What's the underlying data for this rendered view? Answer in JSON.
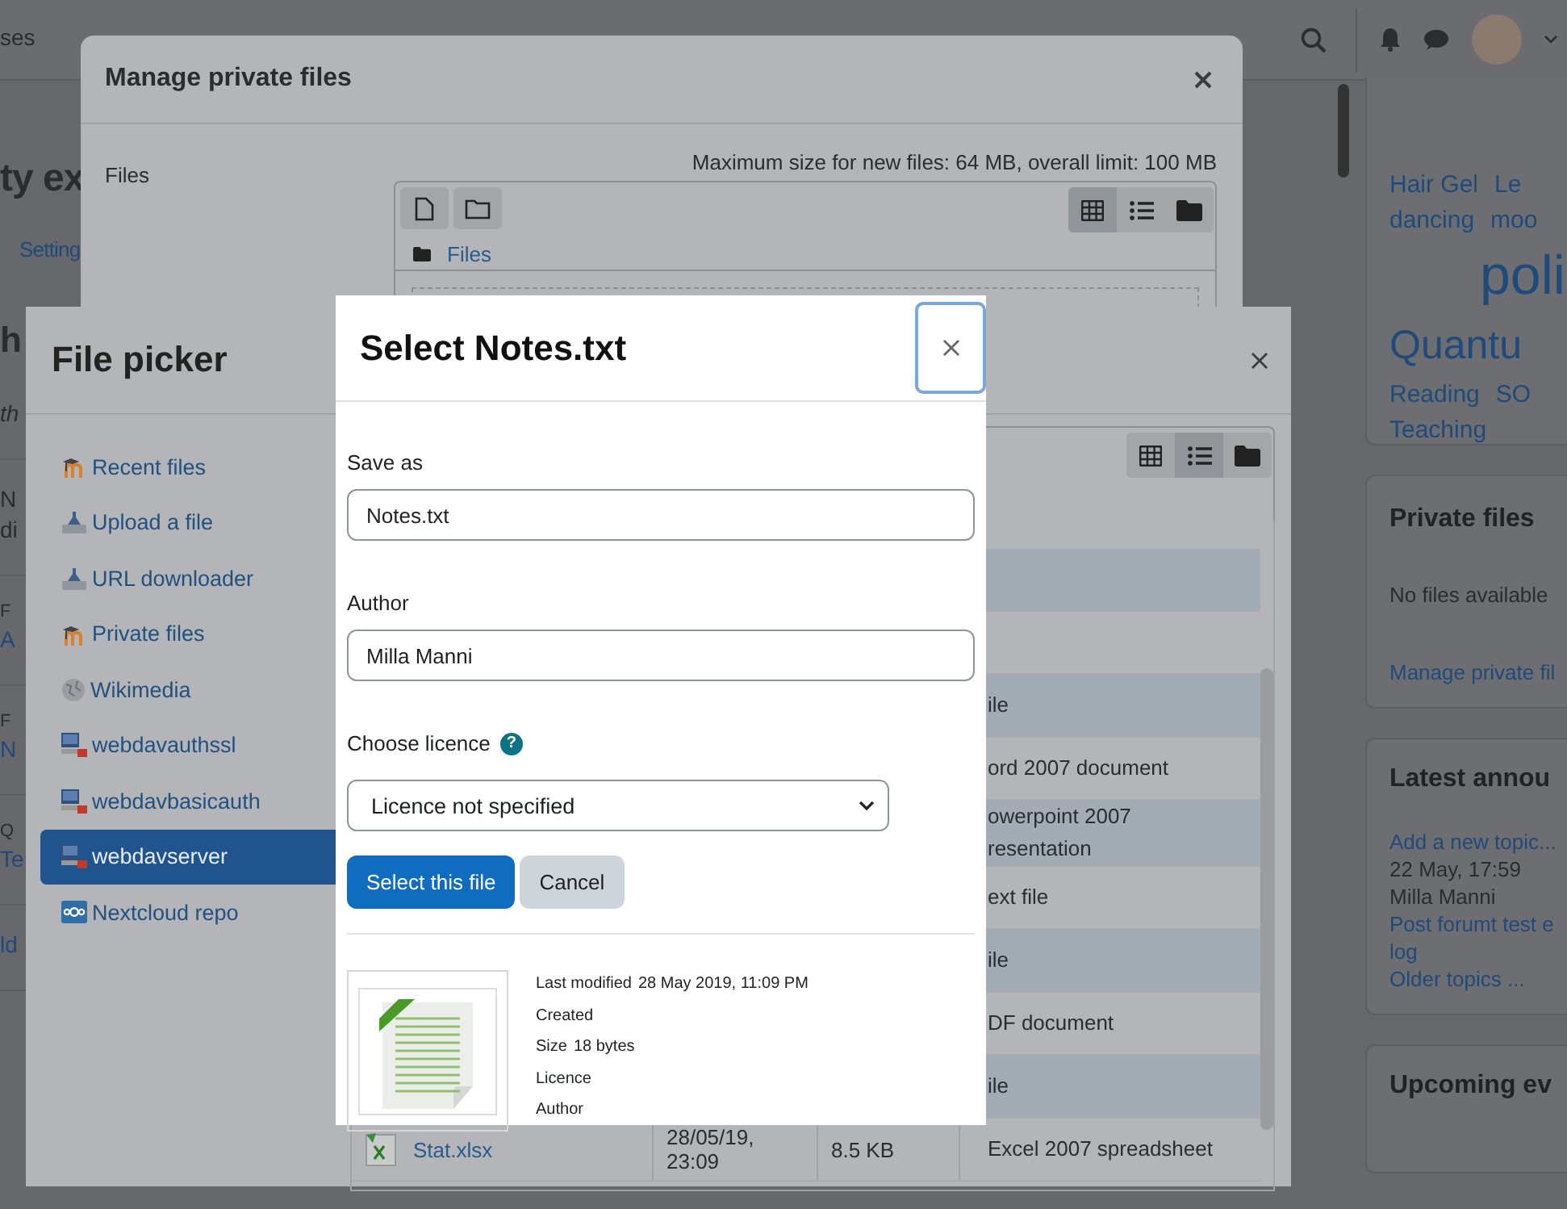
{
  "navbar": {
    "courses_fragment": "ses"
  },
  "page": {
    "title_fragment": "ty ex",
    "settings_link": "Setting",
    "section_heading": "h",
    "blocks": [
      {
        "lines": [
          {
            "text": "th",
            "kind": "italic"
          }
        ]
      },
      {
        "lines": [
          {
            "text": "N",
            "kind": "text"
          },
          {
            "text": "di",
            "kind": "text"
          }
        ]
      },
      {
        "lines": [
          {
            "text": "F",
            "kind": "label"
          },
          {
            "text": "A",
            "kind": "link"
          }
        ]
      },
      {
        "lines": [
          {
            "text": "F",
            "kind": "label"
          },
          {
            "text": "N",
            "kind": "link"
          }
        ]
      },
      {
        "lines": [
          {
            "text": "Q",
            "kind": "label"
          },
          {
            "text": "Te",
            "kind": "link"
          }
        ]
      },
      {
        "lines": [
          {
            "text": "ld",
            "kind": "link"
          }
        ]
      }
    ]
  },
  "sidebar": {
    "tags": [
      {
        "text": "Hair Gel",
        "kind": "small"
      },
      {
        "text": "Le",
        "kind": "small"
      },
      {
        "text": "dancing",
        "kind": "small"
      },
      {
        "text": "moo",
        "kind": "small"
      },
      {
        "text": "poli",
        "kind": "huge"
      },
      {
        "text": "Quantu",
        "kind": "large"
      },
      {
        "text": "Reading",
        "kind": "small"
      },
      {
        "text": "SO",
        "kind": "small"
      },
      {
        "text": "Teaching",
        "kind": "small"
      }
    ],
    "private_files": {
      "title": "Private files",
      "empty_text": "No files available",
      "manage_link": "Manage private fil"
    },
    "announcements": {
      "title": "Latest annou",
      "items": [
        {
          "text": "Add a new topic...",
          "kind": "link"
        },
        {
          "text": "22 May, 17:59",
          "kind": "text"
        },
        {
          "text": "Milla Manni",
          "kind": "text"
        },
        {
          "text": "Post forumt test e",
          "kind": "link"
        },
        {
          "text": "log",
          "kind": "link"
        },
        {
          "text": "Older topics ...",
          "kind": "link"
        }
      ]
    },
    "upcoming": {
      "title": "Upcoming ev"
    }
  },
  "manage_files": {
    "title": "Manage private files",
    "files_label": "Files",
    "limit_text": "Maximum size for new files: 64 MB, overall limit: 100 MB",
    "breadcrumb": "Files",
    "views": [
      {
        "kind": "grid",
        "selected": true
      },
      {
        "kind": "list",
        "selected": false
      },
      {
        "kind": "folder",
        "selected": false
      }
    ]
  },
  "file_picker": {
    "title": "File picker",
    "repositories": [
      {
        "label": "Recent files",
        "kind": "moodle",
        "selected": false
      },
      {
        "label": "Upload a file",
        "kind": "upload",
        "selected": false
      },
      {
        "label": "URL downloader",
        "kind": "upload",
        "selected": false
      },
      {
        "label": "Private files",
        "kind": "moodle",
        "selected": false
      },
      {
        "label": "Wikimedia",
        "kind": "globe",
        "selected": false
      },
      {
        "label": "webdavauthssl",
        "kind": "server",
        "selected": false
      },
      {
        "label": "webdavbasicauth",
        "kind": "server",
        "selected": false
      },
      {
        "label": "webdavserver",
        "kind": "server",
        "selected": true
      },
      {
        "label": "Nextcloud repo",
        "kind": "nextcloud",
        "selected": false
      }
    ],
    "views": [
      {
        "kind": "grid",
        "selected": false
      },
      {
        "kind": "list",
        "selected": true
      },
      {
        "kind": "folder",
        "selected": false
      }
    ],
    "rows": [
      {
        "kind": "covered"
      },
      {
        "kind": "covered"
      },
      {
        "kind": "file",
        "type": "ile"
      },
      {
        "kind": "file",
        "type": "ord 2007 document"
      },
      {
        "kind": "file",
        "type": "owerpoint 2007 resentation"
      },
      {
        "kind": "file",
        "type": "ext file"
      },
      {
        "kind": "file",
        "type": "ile"
      },
      {
        "kind": "file",
        "type": "DF document"
      },
      {
        "kind": "file",
        "type": "ile"
      },
      {
        "kind": "file",
        "name": "Stat.xlsx",
        "date": "28/05/19, 23:09",
        "size": "8.5 KB",
        "type": "Excel 2007 spreadsheet"
      }
    ]
  },
  "select_dialog": {
    "title": "Select Notes.txt",
    "save_as_label": "Save as",
    "save_as_value": "Notes.txt",
    "author_label": "Author",
    "author_value": "Milla Manni",
    "licence_label": "Choose licence",
    "help_icon": "?",
    "licence_value": "Licence not specified",
    "select_button": "Select this file",
    "cancel_button": "Cancel",
    "details": [
      {
        "label": "Last modified",
        "value": "28 May 2019, 11:09 PM"
      },
      {
        "label": "Created"
      },
      {
        "label": "Size",
        "value": "18 bytes"
      },
      {
        "label": "Licence"
      },
      {
        "label": "Author"
      }
    ]
  }
}
